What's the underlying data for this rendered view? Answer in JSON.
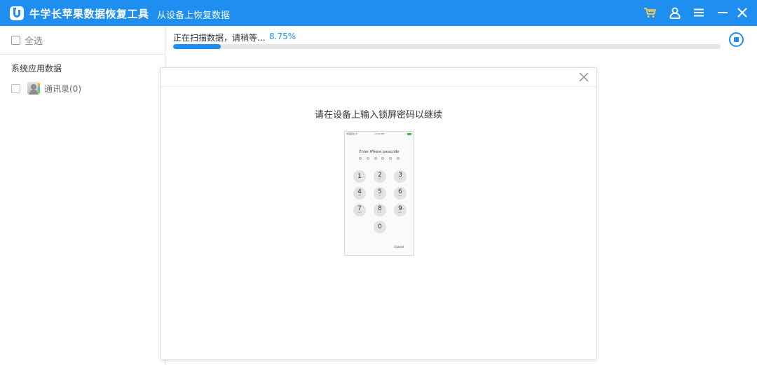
{
  "app": {
    "title": "牛学长苹果数据恢复工具",
    "separator": "-",
    "page_title": "从设备上恢复数据"
  },
  "titlebar_icons": [
    "cart-icon",
    "user-icon",
    "menu-icon",
    "minimize-icon",
    "close-icon"
  ],
  "colors": {
    "accent": "#1f8ef1",
    "cart": "#ffd043"
  },
  "sidebar": {
    "select_all": "全选",
    "section_title": "系统应用数据",
    "items": [
      {
        "label": "通讯录(0)",
        "icon": "contacts-icon"
      }
    ]
  },
  "scan": {
    "status_text": "正在扫描数据，请稍等...",
    "percent_text": "8.75%",
    "progress": 0.0875,
    "stop_icon": "stop-icon"
  },
  "dialog": {
    "message": "请在设备上输入锁屏密码以继续",
    "close_icon": "close-icon",
    "phone": {
      "carrier": "中国移动 令",
      "time": "12:00 PM",
      "prompt": "Enter iPhone passcode",
      "keys": [
        {
          "num": "1",
          "sub": ""
        },
        {
          "num": "2",
          "sub": "ABC"
        },
        {
          "num": "3",
          "sub": "DEF"
        },
        {
          "num": "4",
          "sub": "GHI"
        },
        {
          "num": "5",
          "sub": "JKL"
        },
        {
          "num": "6",
          "sub": "MNO"
        },
        {
          "num": "7",
          "sub": "PQRS"
        },
        {
          "num": "8",
          "sub": "TUV"
        },
        {
          "num": "9",
          "sub": "WXYZ"
        },
        {
          "num": "0",
          "sub": ""
        }
      ],
      "cancel": "Cancel"
    }
  }
}
